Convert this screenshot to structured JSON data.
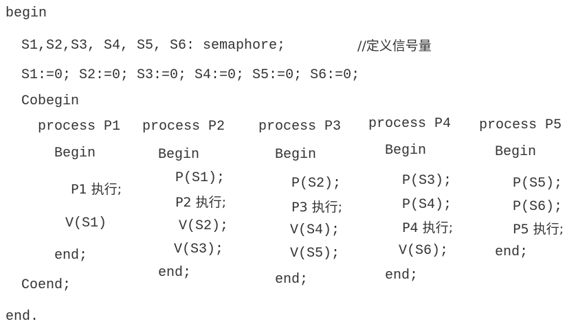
{
  "code": {
    "begin": "begin",
    "declaration": "S1,S2,S3, S4, S5, S6: semaphore;",
    "comment": "//定义信号量",
    "init": "S1:=0; S2:=0; S3:=0; S4:=0; S5:=0; S6:=0;",
    "cobegin": "Cobegin",
    "coend": "Coend;",
    "end": "end."
  },
  "processes": [
    {
      "header": "process P1",
      "begin": "Begin",
      "lines": [
        "P1 执行;",
        "V(S1)"
      ],
      "end": "end;"
    },
    {
      "header": "process P2",
      "begin": "Begin",
      "lines": [
        "P(S1);",
        "P2 执行;",
        "V(S2);",
        "V(S3);"
      ],
      "end": "end;"
    },
    {
      "header": "process P3",
      "begin": "Begin",
      "lines": [
        "P(S2);",
        "P3 执行;",
        "V(S4);",
        "V(S5);"
      ],
      "end": "end;"
    },
    {
      "header": "process P4",
      "begin": "Begin",
      "lines": [
        "P(S3);",
        "P(S4);",
        "P4 执行;",
        "V(S6);"
      ],
      "end": "end;"
    },
    {
      "header": "process P5",
      "begin": "Begin",
      "lines": [
        "P(S5);",
        "P(S6);",
        "P5 执行;"
      ],
      "end": "end;"
    }
  ]
}
